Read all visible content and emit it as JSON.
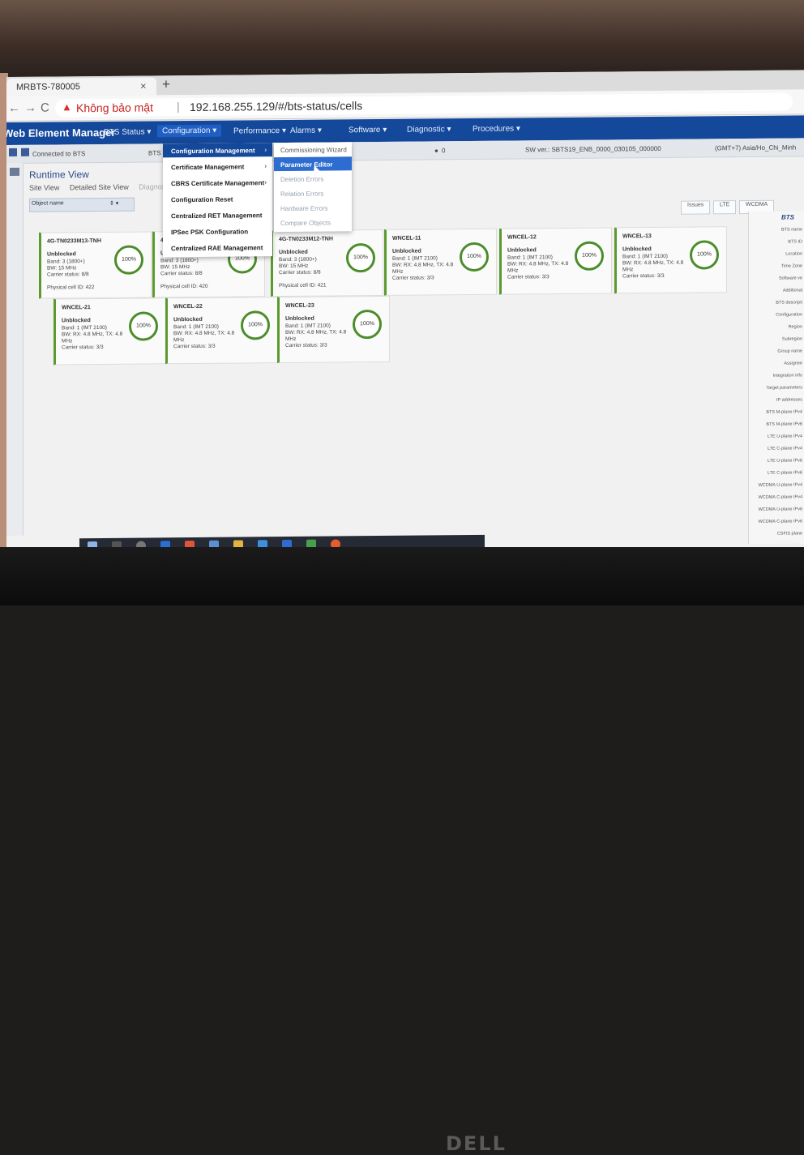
{
  "browser": {
    "tab_title": "MRBTS-780005",
    "tab_close": "×",
    "new_tab": "+",
    "back": "←",
    "forward": "→",
    "reload": "C",
    "security_text": "Không bảo mật",
    "separator": "|",
    "url": "192.168.255.129/#/bts-status/cells"
  },
  "app": {
    "title": "Web Element Manager",
    "menu": [
      {
        "label": "BTS Status ▾"
      },
      {
        "label": "Configuration ▾"
      },
      {
        "label": "Performance ▾"
      },
      {
        "label": "Alarms ▾"
      },
      {
        "label": "Software ▾"
      },
      {
        "label": "Diagnostic ▾"
      },
      {
        "label": "Procedures ▾"
      }
    ]
  },
  "statusbar": {
    "connected": "Connected to BTS",
    "bts_label": "BTS",
    "alarm_count": "0",
    "sw_version": "SW ver.: SBTS19_ENB_0000_030105_000000",
    "timezone": "(GMT+7) Asia/Ho_Chi_Minh"
  },
  "runtime": {
    "title": "Runtime View",
    "subtabs": [
      "Site View",
      "Detailed Site View",
      "Diagnostics"
    ],
    "filter_placeholder": "Object name",
    "filter_select": "⇕ ▾",
    "toolbar": [
      "Issues",
      "LTE",
      "WCDMA"
    ]
  },
  "config_menu": [
    {
      "label": "Configuration Management",
      "arrow": "›"
    },
    {
      "label": "Certificate Management",
      "arrow": "›"
    },
    {
      "label": "CBRS Certificate Management",
      "arrow": "›"
    },
    {
      "label": "Configuration Reset",
      "arrow": ""
    },
    {
      "label": "Centralized RET Management",
      "arrow": ""
    },
    {
      "label": "IPSec PSK Configuration",
      "arrow": ""
    },
    {
      "label": "Centralized RAE Management",
      "arrow": ""
    }
  ],
  "config_submenu": [
    {
      "label": "Commissioning Wizard"
    },
    {
      "label": "Parameter Editor"
    },
    {
      "label": "Deletion Errors"
    },
    {
      "label": "Relation Errors"
    },
    {
      "label": "Hardware Errors"
    },
    {
      "label": "Compare Objects"
    }
  ],
  "cells": [
    {
      "name": "4G-TN0233M13-TNH",
      "status": "Unblocked",
      "lines": [
        "Band: 3 (1800+)",
        "BW: 15 MHz",
        "Carrier status: 8/8",
        "Physical cell ID: 422"
      ],
      "pct": "100%",
      "util": 1.0
    },
    {
      "name": "4G-TN0233M11-TNH",
      "status": "Unblocked",
      "lines": [
        "Band: 3 (1800+)",
        "BW: 15 MHz",
        "Carrier status: 8/8",
        "Physical cell ID: 420"
      ],
      "pct": "100%",
      "util": 1.0
    },
    {
      "name": "4G-TN0233M12-TNH",
      "status": "Unblocked",
      "lines": [
        "Band: 3 (1800+)",
        "BW: 15 MHz",
        "Carrier status: 8/8",
        "Physical cell ID: 421"
      ],
      "pct": "100%",
      "util": 1.0
    },
    {
      "name": "WNCEL-11",
      "status": "Unblocked",
      "lines": [
        "Band: 1 (IMT 2100)",
        "BW: RX: 4.8 MHz, TX: 4.8 MHz",
        "Carrier status: 3/3"
      ],
      "pct": "100%",
      "util": 1.0
    },
    {
      "name": "WNCEL-12",
      "status": "Unblocked",
      "lines": [
        "Band: 1 (IMT 2100)",
        "BW: RX: 4.8 MHz, TX: 4.8 MHz",
        "Carrier status: 3/3"
      ],
      "pct": "100%",
      "util": 1.0
    },
    {
      "name": "WNCEL-13",
      "status": "Unblocked",
      "lines": [
        "Band: 1 (IMT 2100)",
        "BW: RX: 4.8 MHz, TX: 4.8 MHz",
        "Carrier status: 3/3"
      ],
      "pct": "100%",
      "util": 1.0
    },
    {
      "name": "WNCEL-21",
      "status": "Unblocked",
      "lines": [
        "Band: 1 (IMT 2100)",
        "BW: RX: 4.8 MHz, TX: 4.8 MHz",
        "Carrier status: 3/3"
      ],
      "pct": "100%",
      "util": 1.0
    },
    {
      "name": "WNCEL-22",
      "status": "Unblocked",
      "lines": [
        "Band: 1 (IMT 2100)",
        "BW: RX: 4.8 MHz, TX: 4.8 MHz",
        "Carrier status: 3/3"
      ],
      "pct": "100%",
      "util": 1.0
    },
    {
      "name": "WNCEL-23",
      "status": "Unblocked",
      "lines": [
        "Band: 1 (IMT 2100)",
        "BW: RX: 4.8 MHz, TX: 4.8 MHz",
        "Carrier status: 3/3"
      ],
      "pct": "100%",
      "util": 1.0
    }
  ],
  "right_panel": {
    "title": "BTS",
    "items": [
      "BTS name",
      "BTS ID",
      "Location",
      "Time Zone",
      "Software ve",
      "Additional",
      "BTS descripti",
      "Configuration",
      "Region",
      "Subregion",
      "Group name",
      "Assignee",
      "Integration info",
      "Target parameters",
      "IP addresses",
      "BTS M-plane IPv4",
      "BTS M-plane IPv6",
      "LTE U-plane IPv4",
      "LTE C-plane IPv4",
      "LTE U-plane IPv6",
      "LTE C-plane IPv6",
      "WCDMA U-plane IPv4",
      "WCDMA C-plane IPv4",
      "WCDMA U-plane IPv6",
      "WCDMA C-plane IPv6",
      "CSFIS plane"
    ]
  },
  "brand": "DELL",
  "colors": {
    "header": "#14489b",
    "ring": "#4c8d2b",
    "highlight": "#2d6cd0",
    "warning": "#d93025"
  }
}
